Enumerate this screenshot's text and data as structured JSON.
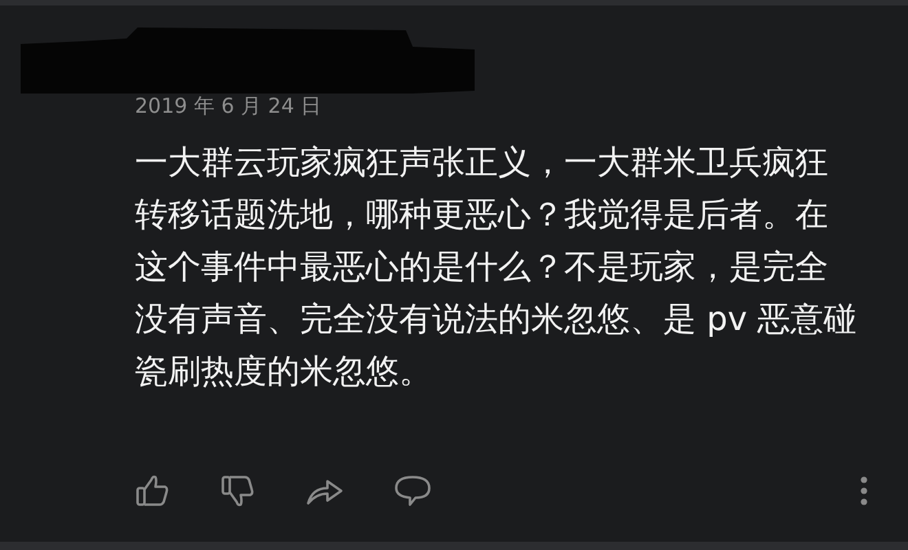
{
  "comment": {
    "date": "2019 年 6 月 24 日",
    "text": "一大群云玩家疯狂声张正义，一大群米卫兵疯狂转移话题洗地，哪种更恶心？我觉得是后者。在这个事件中最恶心的是什么？不是玩家，是完全没有声音、完全没有说法的米忽悠、是 pv 恶意碰瓷刷热度的米忽悠。"
  }
}
